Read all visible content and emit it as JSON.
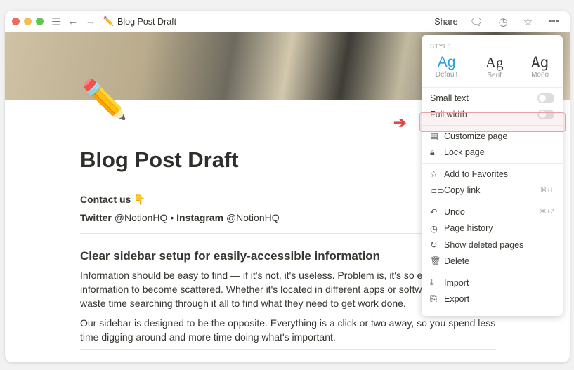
{
  "window": {
    "title": "Blog Post Draft",
    "title_emoji": "✏️",
    "share": "Share"
  },
  "page": {
    "emoji": "✏️",
    "title": "Blog Post Draft",
    "contact": "Contact us 👇",
    "social": {
      "twitter_label": "Twitter",
      "twitter_handle": "@NotionHQ",
      "sep": "•",
      "instagram_label": "Instagram",
      "instagram_handle": "@NotionHQ"
    },
    "heading": "Clear sidebar setup for easily-accessible information",
    "p1": "Information should be easy to find — if it's not, it's useless. Problem is, it's so easy for information to become scattered. Whether it's located in different apps or software, people waste time searching through it all to find what they need to get work done.",
    "p2": "Our sidebar is designed to be the opposite. Everything is a click or two away, so you spend less time digging around and more time doing what's important."
  },
  "menu": {
    "style_label": "STYLE",
    "fonts": [
      {
        "sample": "Ag",
        "name": "Default",
        "color": "#2f9ede"
      },
      {
        "sample": "Ag",
        "name": "Serif"
      },
      {
        "sample": "Ag",
        "name": "Mono"
      }
    ],
    "small_text": "Small text",
    "small_text_on": false,
    "full_width": "Full width",
    "full_width_on": false,
    "items": [
      {
        "label": "Customize page",
        "icon": "page-icon",
        "glyph": "▤"
      },
      {
        "label": "Lock page",
        "icon": "lock-icon",
        "glyph": "🔒︎"
      },
      {
        "label": "Add to Favorites",
        "icon": "star-icon",
        "glyph": "☆"
      },
      {
        "label": "Copy link",
        "icon": "link-icon",
        "glyph": "⊂⊃",
        "shortcut": "⌘+L"
      },
      {
        "label": "Undo",
        "icon": "undo-icon",
        "glyph": "↶",
        "shortcut": "⌘+Z"
      },
      {
        "label": "Page history",
        "icon": "history-icon",
        "glyph": "◷"
      },
      {
        "label": "Show deleted pages",
        "icon": "restore-icon",
        "glyph": "↻"
      },
      {
        "label": "Delete",
        "icon": "trash-icon",
        "glyph": "🗑︎"
      },
      {
        "label": "Import",
        "icon": "import-icon",
        "glyph": "⤓"
      },
      {
        "label": "Export",
        "icon": "export-icon",
        "glyph": "⎘"
      }
    ]
  }
}
